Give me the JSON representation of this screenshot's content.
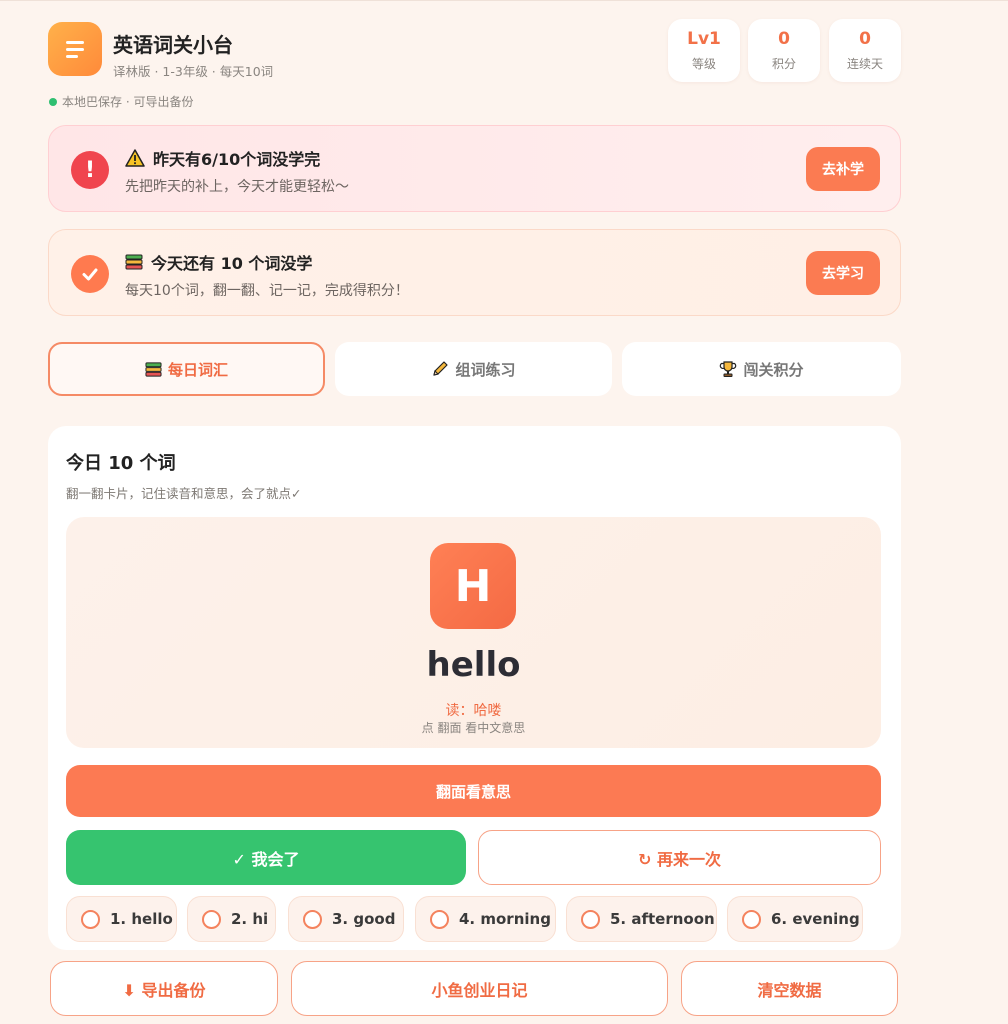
{
  "header": {
    "title": "英语词关小台",
    "subtitle": "译林版 · 1-3年级 · 每天10词",
    "save_status": "本地巴保存 · 可导出备份",
    "stats": [
      {
        "value": "Lv1",
        "label": "等级"
      },
      {
        "value": "0",
        "label": "积分"
      },
      {
        "value": "0",
        "label": "连续天"
      }
    ]
  },
  "missed_banner": {
    "icon": "exclamation-icon",
    "title": "昨天有6/10个词没学完",
    "desc": "先把昨天的补上，今天才能更轻松～",
    "button": "去补学",
    "color": "#f0454e"
  },
  "today_banner": {
    "icon": "check-icon",
    "title": "今天还有 10 个词没学",
    "desc": "每天10个词，翻一翻、记一记，完成得积分！",
    "button": "去学习",
    "color": "#ff7a4f"
  },
  "tabs": [
    {
      "label": "每日词汇",
      "icon": "books-icon",
      "active": true
    },
    {
      "label": "组词练习",
      "icon": "pencil-icon",
      "active": false
    },
    {
      "label": "闯关积分",
      "icon": "trophy-icon",
      "active": false
    }
  ],
  "daily": {
    "title": "今日 10 个词",
    "subtitle": "翻一翻卡片，记住读音和意思，会了就点✓",
    "card": {
      "letter": "H",
      "word": "hello",
      "reading": "读：哈喽",
      "hint": "点 翻面 看中文意思"
    },
    "flip_button": "翻面看意思",
    "know_button": "✓ 我会了",
    "again_button": "↻ 再来一次",
    "words": [
      "1. hello",
      "2. hi",
      "3. good",
      "4. morning",
      "5. afternoon",
      "6. evening"
    ]
  },
  "footer": {
    "export": "⬇ 导出备份",
    "diary": "小鱼创业日记",
    "clear": "清空数据"
  },
  "colors": {
    "accent": "#fc7a53",
    "success": "#36c46f",
    "background": "#fdf4ee"
  }
}
